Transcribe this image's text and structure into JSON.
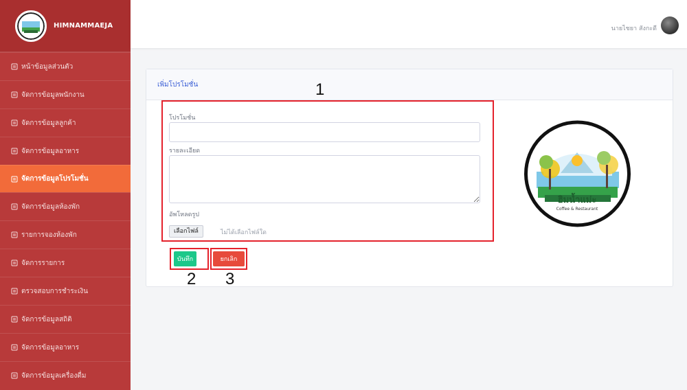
{
  "brand": {
    "name": "HIMNAMMAEJA"
  },
  "sidebar": {
    "items": [
      {
        "label": "หน้าข้อมูลส่วนตัว",
        "active": false
      },
      {
        "label": "จัดการข้อมูลพนักงาน",
        "active": false
      },
      {
        "label": "จัดการข้อมูลลูกค้า",
        "active": false
      },
      {
        "label": "จัดการข้อมูลอาหาร",
        "active": false
      },
      {
        "label": "จัดการข้อมูลโปรโมชั่น",
        "active": true
      },
      {
        "label": "จัดการข้อมูลห้องพัก",
        "active": false
      },
      {
        "label": "รายการจองห้องพัก",
        "active": false
      },
      {
        "label": "จัดการรายการ",
        "active": false
      },
      {
        "label": "ตรวจสอบการชำระเงิน",
        "active": false
      },
      {
        "label": "จัดการข้อมูลสถิติ",
        "active": false
      },
      {
        "label": "จัดการข้อมูลอาหาร",
        "active": false
      },
      {
        "label": "จัดการข้อมูลเครื่องดื่ม",
        "active": false
      }
    ]
  },
  "topbar": {
    "user_name": "นายไชยา สังกะดี"
  },
  "card": {
    "title": "เพิ่มโปรโมชั่น"
  },
  "form": {
    "name_label": "โปรโมชั่น",
    "name_value": "",
    "detail_label": "รายละเอียด",
    "detail_value": "",
    "image_label": "อัพโหลดรูป",
    "file_button": "เลือกไฟล์",
    "file_status": "ไม่ได้เลือกไฟล์ใด"
  },
  "buttons": {
    "save": "บันทึก",
    "cancel": "ยกเลิก"
  },
  "callouts": [
    "1",
    "2",
    "3"
  ],
  "logo": {
    "text_main": "ฮิมน้ำแม่ะ",
    "text_sub": "Coffee & Restaurant"
  },
  "colors": {
    "sidebar": "#b83a3a",
    "active": "#f26b3a",
    "highlight": "#e4212b",
    "save": "#1cc88a",
    "cancel": "#e74a3b",
    "title": "#3b5fd6"
  }
}
